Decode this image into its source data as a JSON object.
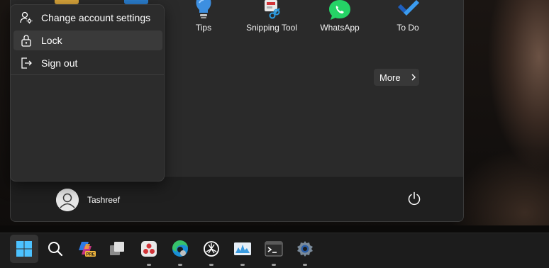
{
  "start_menu": {
    "pinned_apps": [
      {
        "label": "Tips",
        "icon": "tips-icon"
      },
      {
        "label": "Snipping Tool",
        "icon": "snipping-tool-icon"
      },
      {
        "label": "WhatsApp",
        "icon": "whatsapp-icon"
      },
      {
        "label": "To Do",
        "icon": "todo-icon"
      }
    ],
    "more_label": "More",
    "user_name": "Tashreef",
    "power_icon": "power-icon"
  },
  "account_flyout": {
    "items": [
      {
        "label": "Change account settings",
        "icon": "account-settings-icon"
      },
      {
        "label": "Lock",
        "icon": "lock-icon"
      },
      {
        "label": "Sign out",
        "icon": "sign-out-icon"
      }
    ]
  },
  "taskbar": {
    "copilot_badge": "PRE",
    "apps": [
      "start-icon",
      "search-icon",
      "copilot-icon",
      "task-view-icon",
      "app-icon",
      "edge-icon",
      "chatgpt-icon",
      "performance-monitor-icon",
      "terminal-icon",
      "settings-icon"
    ]
  },
  "colors": {
    "menu_bg": "#2a2a2a",
    "flyout_bg": "#2c2c2c",
    "taskbar_bg": "#1c1c1c",
    "accent_blue": "#0078d4",
    "whatsapp_green": "#25d366"
  }
}
